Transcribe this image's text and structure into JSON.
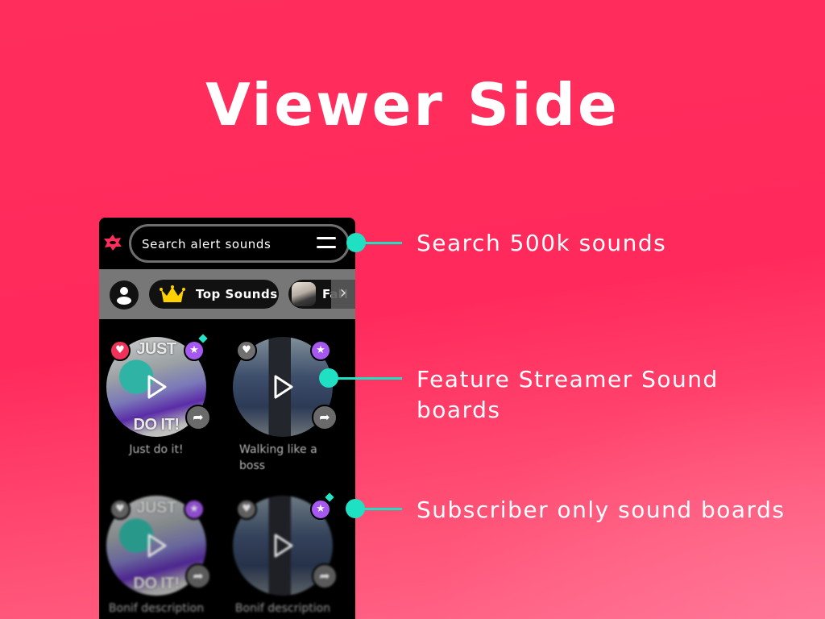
{
  "page": {
    "title": "Viewer Side",
    "colors": {
      "background": "#ff2a5b",
      "accent": "#1fe0c3",
      "favorite": "#f0315a",
      "subscriber": "#a659f0"
    }
  },
  "app": {
    "logo_icon": "star-splat-logo-icon",
    "search": {
      "placeholder": "Search alert sounds",
      "menu_icon": "hamburger-menu-icon"
    },
    "categories": [
      {
        "icon": "user-profile-icon",
        "label": ""
      },
      {
        "icon": "crown-icon",
        "label": "Top Sounds"
      },
      {
        "icon": "streamer-avatar",
        "label": "FaH"
      }
    ],
    "scroll_next_icon": "chevron-right-icon",
    "scroll_next_glyph": "›",
    "sounds": [
      {
        "caption": "Just do it!",
        "image_text_top": "JUST",
        "image_text_bottom": "DO IT!",
        "favorited": true,
        "subscriber_badge": true
      },
      {
        "caption": "Walking like a boss",
        "image_text_top": "",
        "image_text_bottom": "",
        "favorited": false,
        "subscriber_badge": true
      },
      {
        "caption": "Bonif description",
        "image_text_top": "JUST",
        "image_text_bottom": "DO IT!",
        "favorited": false,
        "subscriber_badge": true
      },
      {
        "caption": "Bonif description",
        "image_text_top": "",
        "image_text_bottom": "",
        "favorited": false,
        "subscriber_badge": true
      }
    ],
    "glyphs": {
      "heart": "♥",
      "star": "★",
      "share": "➦"
    }
  },
  "callouts": [
    {
      "text": "Search 500k sounds"
    },
    {
      "text": "Feature Streamer Sound boards"
    },
    {
      "text": "Subscriber only sound boards"
    }
  ]
}
